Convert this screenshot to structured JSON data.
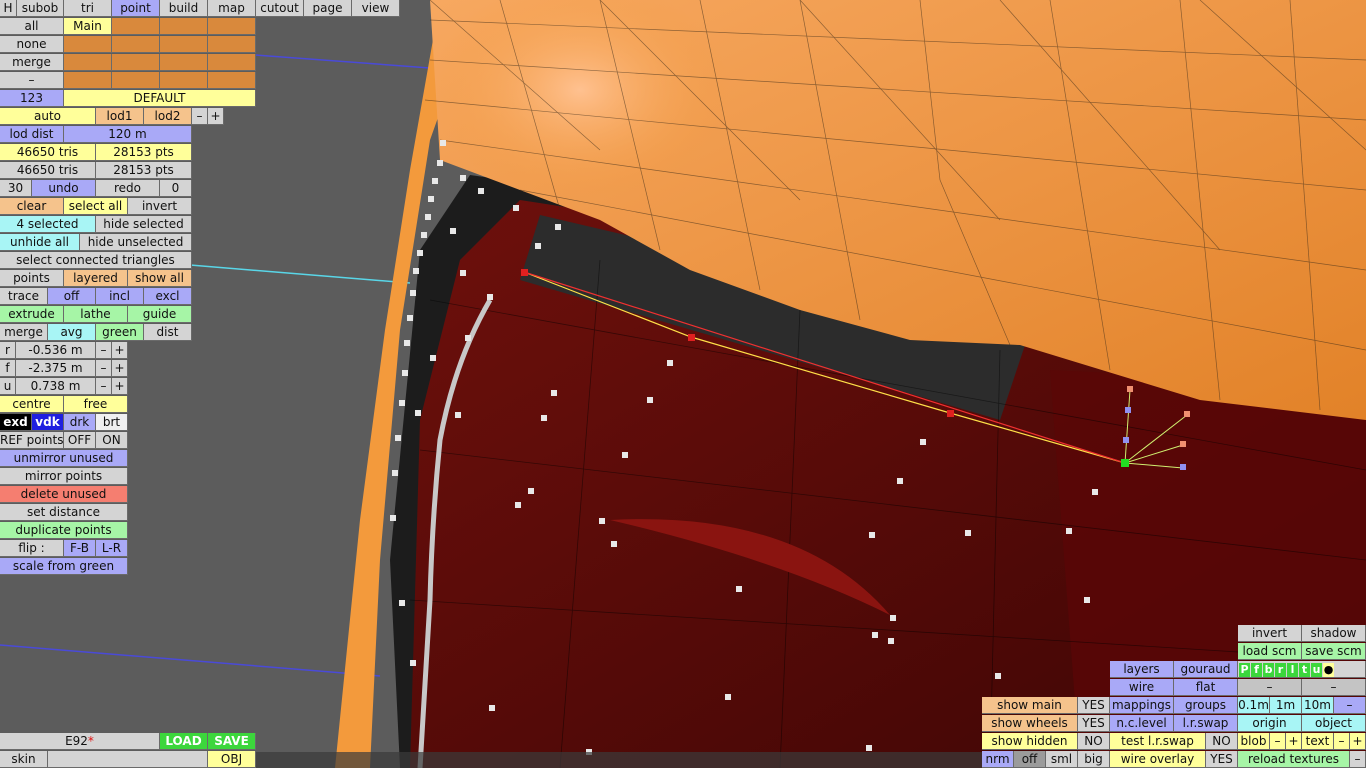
{
  "top_menu": [
    "H",
    "subob",
    "tri",
    "point",
    "build",
    "map",
    "cutout",
    "page",
    "view"
  ],
  "selection": {
    "all_label": "all",
    "none_label": "none",
    "merge_label": "merge",
    "minus_label": "–",
    "main_label": "Main",
    "count": "123",
    "default_label": "DEFAULT"
  },
  "lod": {
    "auto": "auto",
    "lod1": "lod1",
    "lod2": "lod2",
    "minus": "–",
    "plus": "+",
    "dist_label": "lod dist",
    "dist_value": "120 m"
  },
  "stats": {
    "tris1": "46650 tris",
    "pts1": "28153 pts",
    "tris2": "46650 tris",
    "pts2": "28153 pts"
  },
  "undo": {
    "count": "30",
    "undo_label": "undo",
    "redo_label": "redo",
    "redo_count": "0"
  },
  "actions": {
    "clear": "clear",
    "select_all": "select all",
    "invert": "invert",
    "selected": "4 selected",
    "hide_selected": "hide selected",
    "unhide_all": "unhide all",
    "hide_unselected": "hide unselected",
    "select_connected": "select connected triangles",
    "points": "points",
    "layered": "layered",
    "show_all": "show all",
    "trace": "trace",
    "off": "off",
    "incl": "incl",
    "excl": "excl",
    "extrude": "extrude",
    "lathe": "lathe",
    "guide": "guide",
    "merge": "merge",
    "avg": "avg",
    "green": "green",
    "dist": "dist"
  },
  "coords": [
    {
      "axis": "r",
      "value": "-0.536 m"
    },
    {
      "axis": "f",
      "value": "-2.375 m"
    },
    {
      "axis": "u",
      "value": "0.738 m"
    }
  ],
  "pivot": {
    "centre": "centre",
    "free": "free"
  },
  "display": {
    "exd": "exd",
    "vdk": "vdk",
    "drk": "drk",
    "brt": "brt"
  },
  "ref": {
    "label": "REF points",
    "off": "OFF",
    "on": "ON"
  },
  "tools": {
    "unmirror_unused": "unmirror unused",
    "mirror_points": "mirror points",
    "delete_unused": "delete unused",
    "set_distance": "set distance",
    "duplicate_points": "duplicate points",
    "flip_label": "flip :",
    "flip_fb": "F-B",
    "flip_lr": "L-R",
    "scale_from_green": "scale from green"
  },
  "file": {
    "name": "E92",
    "modified": "*",
    "load": "LOAD",
    "save": "SAVE",
    "skin": "skin",
    "obj": "OBJ"
  },
  "right_panel": {
    "invert": "invert",
    "shadow": "shadow",
    "load_scm": "load scm",
    "save_scm": "save scm",
    "flags": [
      "P",
      "f",
      "b",
      "r",
      "l",
      "t",
      "u",
      "●"
    ],
    "layers": "layers",
    "gouraud": "gouraud",
    "wire": "wire",
    "flat": "flat",
    "dash": "–",
    "mappings": "mappings",
    "groups": "groups",
    "m01": "0.1m",
    "m1": "1m",
    "m10": "10m",
    "nc_level": "n.c.level",
    "lr_swap": "l.r.swap",
    "origin": "origin",
    "object": "object",
    "test_lr_swap": "test l.r.swap",
    "no": "NO",
    "blob": "blob",
    "minus": "–",
    "plus": "+",
    "text": "text",
    "wire_overlay": "wire overlay",
    "yes": "YES",
    "reload_textures": "reload textures",
    "show_main": "show main",
    "show_wheels": "show wheels",
    "show_hidden": "show hidden",
    "nrm": "nrm",
    "off": "off",
    "sml": "sml",
    "big": "big"
  },
  "colors": {
    "body_orange": "#f39a3c",
    "interior_red": "#5a0a08",
    "selected_point": "#e02020",
    "green_point": "#22dd22"
  }
}
